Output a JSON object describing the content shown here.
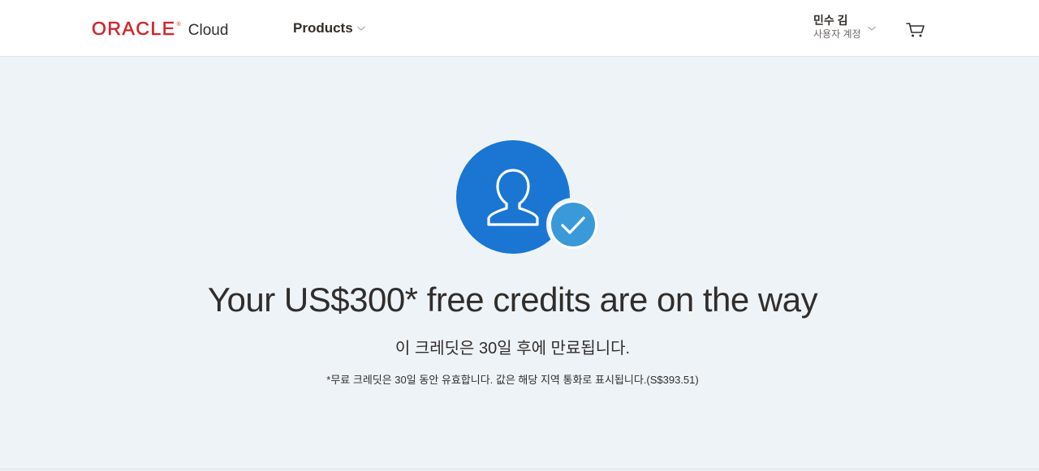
{
  "header": {
    "logo": {
      "brand": "ORACLE",
      "registered": "®",
      "product": "Cloud"
    },
    "nav": {
      "products_label": "Products"
    },
    "user": {
      "name": "민수 김",
      "account_label": "사용자 계정"
    }
  },
  "main": {
    "icons": [
      "user-icon",
      "checkmark-badge-icon"
    ],
    "headline": "Your US$300* free credits are on the way",
    "subline": "이 크레딧은 30일 후에 만료됩니다.",
    "footnote": "*무료 크레딧은 30일 동안 유효합니다. 값은 해당 지역 통화로 표시됩니다.(S$393.51)"
  },
  "colors": {
    "brand_red": "#d0282f",
    "accent_blue": "#1a76d2",
    "badge_blue": "#3a9ad9",
    "page_bg": "#eef3f8"
  }
}
